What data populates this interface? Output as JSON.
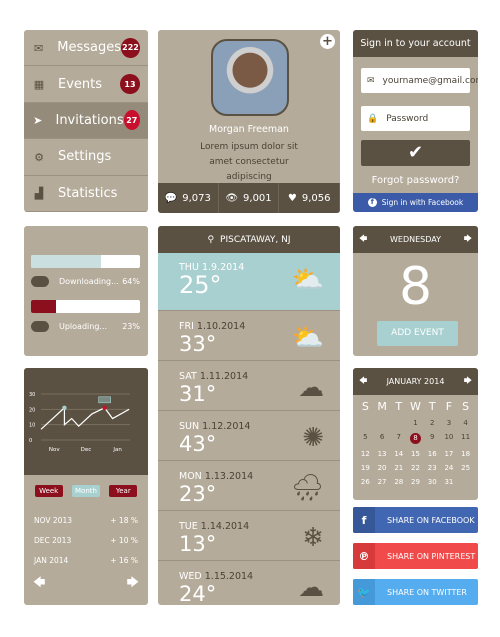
{
  "colors": {
    "panel": "#b5ab9a",
    "dark": "#5a5142",
    "badge": "#8b0f1c",
    "accent": "#a9d0d0",
    "facebook": "#4267b2",
    "pinterest": "#f04a4a",
    "twitter": "#55acee"
  },
  "menu": {
    "items": [
      {
        "label": "Messages",
        "count": "222",
        "icon": "envelope-icon"
      },
      {
        "label": "Events",
        "count": "13",
        "icon": "calendar-icon"
      },
      {
        "label": "Invitations",
        "count": "27",
        "icon": "paper-plane-icon",
        "active": true
      },
      {
        "label": "Settings",
        "icon": "gear-icon"
      },
      {
        "label": "Statistics",
        "icon": "bar-chart-icon"
      }
    ]
  },
  "profile": {
    "name": "Morgan Freeman",
    "bio": "Lorem ipsum dolor sit amet consectetur adipiscing",
    "comments": "9,073",
    "views": "9,001",
    "likes": "9,056"
  },
  "signin": {
    "title": "Sign in to your account",
    "email_value": "yourname@gmail.com",
    "password_placeholder": "Password",
    "forgot": "Forgot password?",
    "facebook": "Sign in with Facebook"
  },
  "progress": {
    "download_label": "Downloading...",
    "download_pct": "64%",
    "download_value": 0.64,
    "upload_label": "Uploading...",
    "upload_pct": "23%",
    "upload_value": 0.23
  },
  "chart_data": {
    "type": "line",
    "categories": [
      "Nov",
      "Dec",
      "Jan"
    ],
    "y_ticks": [
      "30",
      "20",
      "10",
      "0"
    ],
    "ylim": [
      0,
      30
    ],
    "grid": true,
    "points": [
      {
        "x": -0.42,
        "y": 7
      },
      {
        "x": 0.32,
        "y": 21
      },
      {
        "x": 0.32,
        "y": 10
      },
      {
        "x": 0.55,
        "y": 14
      },
      {
        "x": 0.77,
        "y": 9
      },
      {
        "x": 1.19,
        "y": 17
      },
      {
        "x": 1.59,
        "y": 21
      },
      {
        "x": 1.84,
        "y": 14
      },
      {
        "x": 2.36,
        "y": 20
      }
    ]
  },
  "chart_controls": {
    "week": "Week",
    "month": "Month",
    "year": "Year"
  },
  "stats_list": [
    {
      "label": "NOV 2013",
      "value": "+ 18 %"
    },
    {
      "label": "DEC 2013",
      "value": "+ 10 %"
    },
    {
      "label": "JAN 2014",
      "value": "+ 16 %"
    }
  ],
  "weather": {
    "location": "PISCATAWAY, NJ",
    "days": [
      {
        "day": "THU",
        "date": "1.9.2014",
        "temp": "25°",
        "icon": "partly-cloudy-icon"
      },
      {
        "day": "FRI",
        "date": "1.10.2014",
        "temp": "33°",
        "icon": "partly-cloudy-icon"
      },
      {
        "day": "SAT",
        "date": "1.11.2014",
        "temp": "31°",
        "icon": "cloud-icon"
      },
      {
        "day": "SUN",
        "date": "1.12.2014",
        "temp": "43°",
        "icon": "sun-icon"
      },
      {
        "day": "MON",
        "date": "1.13.2014",
        "temp": "23°",
        "icon": "rain-icon"
      },
      {
        "day": "TUE",
        "date": "1.14.2014",
        "temp": "13°",
        "icon": "snowflake-icon"
      },
      {
        "day": "WED",
        "date": "1.15.2014",
        "temp": "24°",
        "icon": "cloud-icon"
      }
    ]
  },
  "day_widget": {
    "weekday": "WEDNESDAY",
    "day": "8",
    "add_event": "ADD EVENT"
  },
  "calendar": {
    "month": "JANUARY 2014",
    "weekdays": [
      "S",
      "M",
      "T",
      "W",
      "T",
      "F",
      "S"
    ],
    "first_offset": 3,
    "days": 31,
    "selected": 8
  },
  "share": {
    "facebook": "SHARE ON FACEBOOK",
    "pinterest": "SHARE ON PINTEREST",
    "twitter": "SHARE ON TWITTER"
  }
}
